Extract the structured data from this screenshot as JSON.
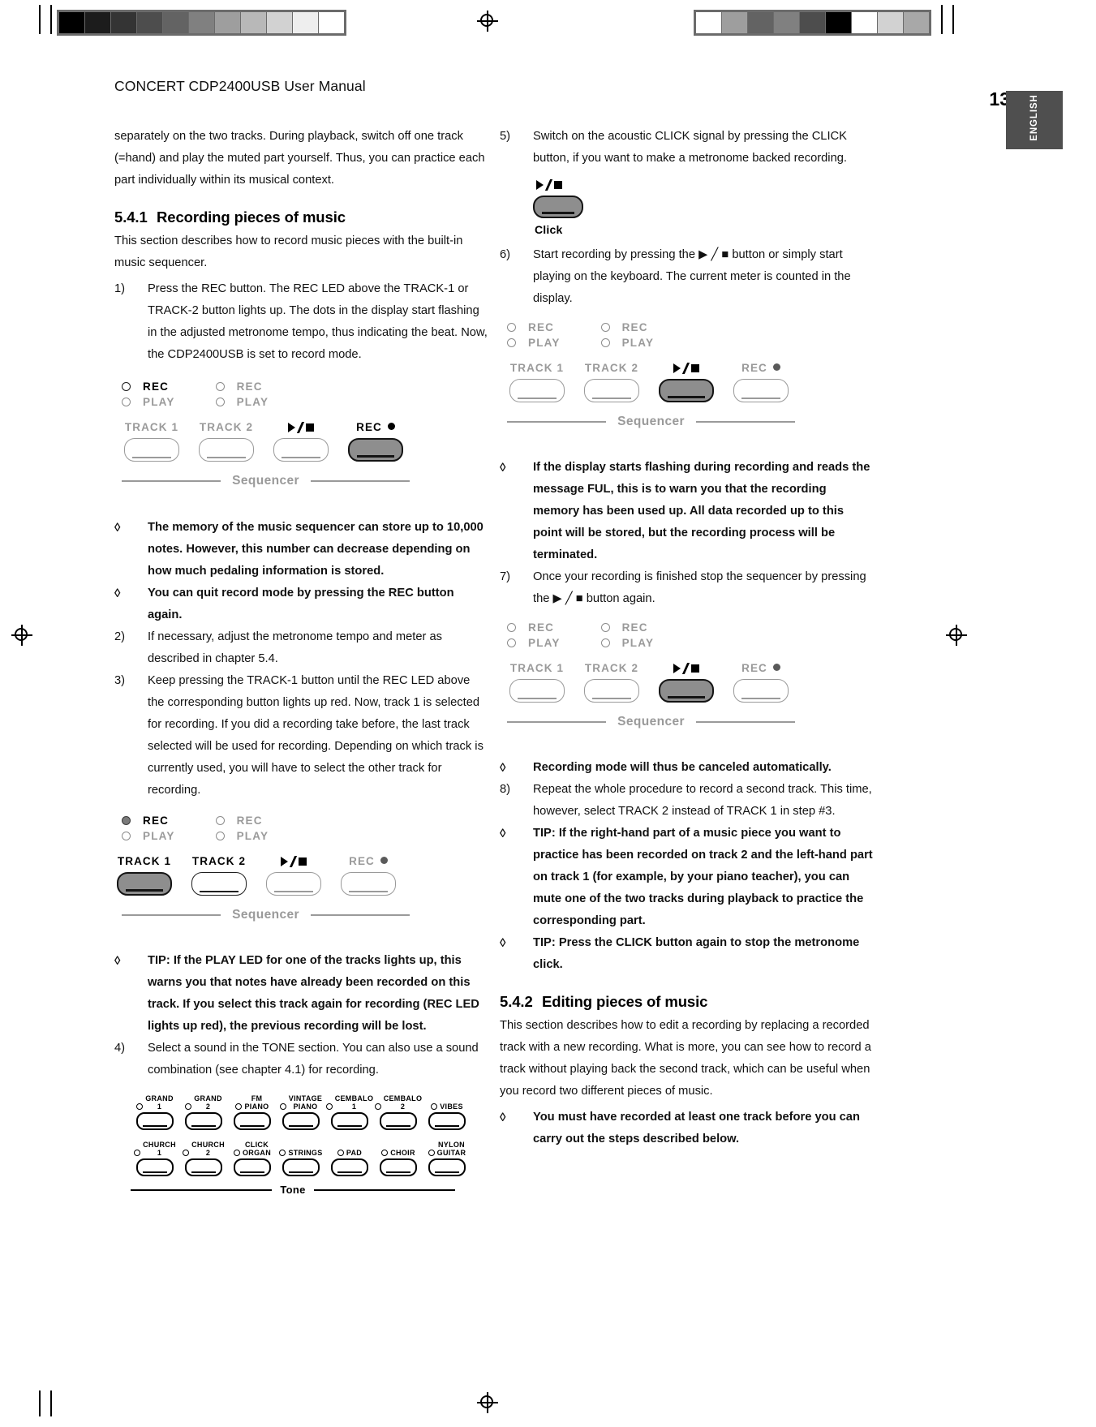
{
  "header": {
    "title": "CONCERT CDP2400USB User Manual",
    "page_number": "13",
    "language_tab": "ENGLISH"
  },
  "left_column": {
    "intro_paragraph": "separately on the two tracks. During playback, switch off one track (=hand) and play the muted part yourself. Thus, you can practice each part individually within its musical context.",
    "section_number": "5.4.1",
    "section_title": "Recording pieces of music",
    "section_intro": "This section describes how to record music pieces with the built-in music sequencer.",
    "step1_mark": "1)",
    "step1_text": "Press the REC button. The REC LED above the TRACK-1 or TRACK-2 button lights up. The dots in the display start flashing in the adjusted metronome tempo, thus indicating the beat. Now, the CDP2400USB is set to record mode.",
    "tip1_mark": "◊",
    "tip1_text": "The memory of the music sequencer can store up to 10,000 notes. However, this number can decrease depending on how much pedaling information is stored.",
    "tip2_mark": "◊",
    "tip2_text": "You can quit record mode by pressing the REC button again.",
    "step2_mark": "2)",
    "step2_text": "If necessary, adjust the metronome tempo and meter as described in chapter 5.4.",
    "step3_mark": "3)",
    "step3_text": "Keep pressing the TRACK-1 button until the REC LED above the corresponding button lights up red. Now, track 1 is selected for recording. If you did a recording take before, the last track selected will be used for recording. Depending on which track is currently used, you will have to select the other track for recording.",
    "tip3_mark": "◊",
    "tip3_text": "TIP: If the PLAY LED for one of the tracks lights up, this warns you that notes have already been recorded on this track. If you select this track again for recording (REC LED lights up red), the previous recording will be lost.",
    "step4_mark": "4)",
    "step4_text": "Select a sound in the TONE section. You can also use a sound combination (see chapter 4.1) for recording."
  },
  "right_column": {
    "step5_mark": "5)",
    "step5_text": "Switch on the acoustic CLICK signal by pressing the CLICK button, if you want to make a metronome backed recording.",
    "click_label": "Click",
    "step6_mark": "6)",
    "step6_text": "Start recording by pressing the ▶ ╱ ■ button or simply start playing on the keyboard. The current meter is counted in the display.",
    "tip4_mark": "◊",
    "tip4_text": "If the display starts flashing during recording and reads the message FUL, this is to warn you that the recording memory has been used up. All data recorded up to this point will be stored, but the recording process will be terminated.",
    "step7_mark": "7)",
    "step7_text": "Once your recording is finished stop the sequencer by pressing the ▶ ╱ ■ button again.",
    "tip5_mark": "◊",
    "tip5_text": "Recording mode will thus be canceled automatically.",
    "step8_mark": "8)",
    "step8_text": "Repeat the whole procedure to record a second track. This time, however, select TRACK 2 instead of TRACK 1 in step #3.",
    "tip6_mark": "◊",
    "tip6_text": "TIP: If the right-hand part of a music piece you want to practice has been recorded on track 2 and the left-hand part on track 1 (for example, by your piano teacher), you can mute one of the two tracks during playback to practice the corresponding part.",
    "tip7_mark": "◊",
    "tip7_text": "TIP: Press the CLICK button again to stop the metronome click.",
    "section_number": "5.4.2",
    "section_title": "Editing pieces of music",
    "section_intro": "This section describes how to edit a recording by replacing a recorded track with a new recording. What is more, you can see how to record a track without playing back the second track, which can be useful when you record two different pieces of music.",
    "tip8_mark": "◊",
    "tip8_text": "You must have recorded at least one track before you can carry out the steps described below."
  },
  "sequencer_panel": {
    "led_rec": "REC",
    "led_play": "PLAY",
    "track1_label": "TRACK 1",
    "track2_label": "TRACK 2",
    "rec_label": "REC",
    "footer_label": "Sequencer"
  },
  "tone_panel": {
    "footer_label": "Tone",
    "row1": [
      {
        "line1": "GRAND",
        "line2": "1"
      },
      {
        "line1": "GRAND",
        "line2": "2"
      },
      {
        "line1": "FM",
        "line2": "PIANO"
      },
      {
        "line1": "VINTAGE",
        "line2": "PIANO"
      },
      {
        "line1": "CEMBALO",
        "line2": "1"
      },
      {
        "line1": "CEMBALO",
        "line2": "2"
      },
      {
        "line1": "",
        "line2": "VIBES"
      }
    ],
    "row2": [
      {
        "line1": "CHURCH",
        "line2": "1"
      },
      {
        "line1": "CHURCH",
        "line2": "2"
      },
      {
        "line1": "CLICK",
        "line2": "ORGAN"
      },
      {
        "line1": "",
        "line2": "STRINGS"
      },
      {
        "line1": "",
        "line2": "PAD"
      },
      {
        "line1": "",
        "line2": "CHOIR"
      },
      {
        "line1": "NYLON",
        "line2": "GUITAR"
      }
    ]
  },
  "colors": {
    "tab_background": "#4f4f4f",
    "button_highlight": "#8e8e8e",
    "label_gray": "#9a9a9a"
  }
}
